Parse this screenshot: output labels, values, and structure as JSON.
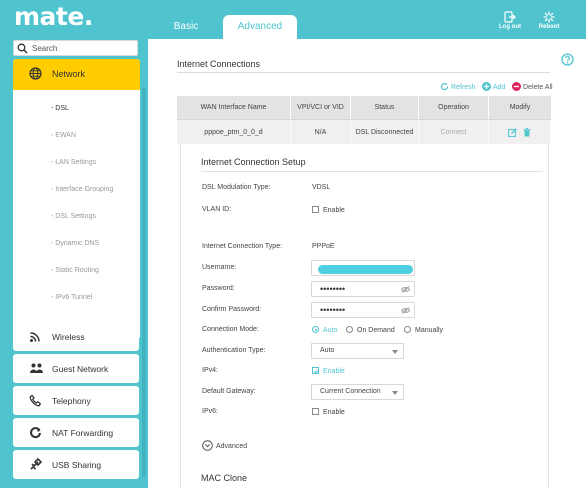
{
  "app": {
    "logo": "mate."
  },
  "tabs": [
    {
      "label": "Basic",
      "active": false
    },
    {
      "label": "Advanced",
      "active": true
    }
  ],
  "topbar": {
    "logout_label": "Log out",
    "reboot_label": "Reboot"
  },
  "sidebar": {
    "search_placeholder": "Search",
    "network": {
      "label": "Network",
      "items": [
        "- DSL",
        "- EWAN",
        "- LAN Settings",
        "- Interface Grouping",
        "- DSL Settings",
        "- Dynamic DNS",
        "- Static Routing",
        "- IPv6 Tunnel"
      ],
      "active_item": "- DSL"
    },
    "nav": [
      {
        "label": "Wireless",
        "icon": "wifi-icon"
      },
      {
        "label": "Guest Network",
        "icon": "guest-network-icon"
      },
      {
        "label": "Telephony",
        "icon": "phone-icon"
      },
      {
        "label": "NAT Forwarding",
        "icon": "nat-forwarding-icon"
      },
      {
        "label": "USB Sharing",
        "icon": "usb-icon"
      }
    ]
  },
  "main": {
    "section_title": "Internet Connections",
    "actions": {
      "refresh": "Refresh",
      "add": "Add",
      "delete_all": "Delete All"
    },
    "table": {
      "headers": [
        "WAN Interface Name",
        "VPI/VCI or VID",
        "Status",
        "Operation",
        "Modify"
      ],
      "rows": [
        {
          "name": "pppoe_ptm_0_0_d",
          "vpi": "N/A",
          "status": "DSL Disconnected",
          "operation": "Connect"
        }
      ]
    },
    "setup": {
      "title": "Internet Connection Setup",
      "dsl_mod_label": "DSL Modulation Type:",
      "dsl_mod_value": "VDSL",
      "vlan_label": "VLAN ID:",
      "vlan_enable": "Enable",
      "conn_type_label": "Internet Connection Type:",
      "conn_type_value": "PPPoE",
      "username_label": "Username:",
      "password_label": "Password:",
      "password_value": "••••••••",
      "confirm_label": "Confirm Password:",
      "confirm_value": "••••••••",
      "conn_mode_label": "Connection Mode:",
      "conn_mode_options": [
        "Auto",
        "On Demand",
        "Manually"
      ],
      "conn_mode_selected": "Auto",
      "auth_label": "Authentication Type:",
      "auth_value": "Auto",
      "ipv4_label": "IPv4:",
      "ipv4_enable": "Enable",
      "ipv4_checked": true,
      "gateway_label": "Default Gateway:",
      "gateway_value": "Current Connection",
      "ipv6_label": "IPv6:",
      "ipv6_enable": "Enable",
      "ipv6_checked": false,
      "advanced_label": "Advanced",
      "mac_clone_title": "MAC Clone"
    }
  },
  "colors": {
    "accent": "#4fc4cf",
    "network_highlight": "#ffcc00",
    "delete": "#e0245e"
  }
}
